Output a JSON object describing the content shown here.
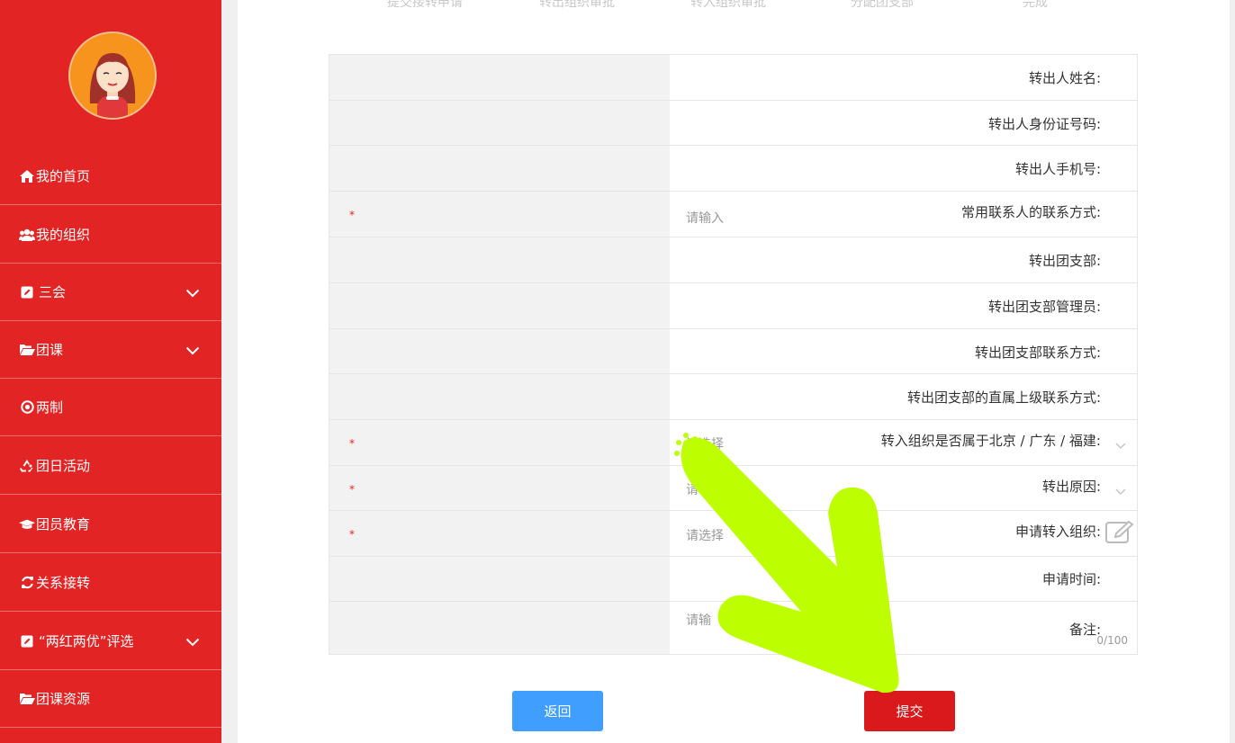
{
  "sidebar": {
    "items": [
      {
        "label": "我的首页",
        "icon": "home-icon"
      },
      {
        "label": "我的组织",
        "icon": "users-icon"
      },
      {
        "label": "三会",
        "icon": "edit-icon",
        "expandable": true
      },
      {
        "label": "团课",
        "icon": "folder-open-icon",
        "expandable": true
      },
      {
        "label": "两制",
        "icon": "target-icon"
      },
      {
        "label": "团日活动",
        "icon": "recycle-icon"
      },
      {
        "label": "团员教育",
        "icon": "graduation-cap-icon"
      },
      {
        "label": "关系接转",
        "icon": "refresh-icon"
      },
      {
        "label": "“两红两优”评选",
        "icon": "edit-icon",
        "expandable": true
      },
      {
        "label": "团课资源",
        "icon": "folder-open-icon"
      }
    ]
  },
  "steps": [
    "提交接转申请",
    "转出组织审批",
    "转入组织审批",
    "分配团支部",
    "完成"
  ],
  "form": {
    "rows": [
      {
        "label": "转出人姓名:",
        "required": false,
        "value": ""
      },
      {
        "label": "转出人身份证号码:",
        "required": false,
        "value": ""
      },
      {
        "label": "转出人手机号:",
        "required": false,
        "value": ""
      },
      {
        "label": "常用联系人的联系方式:",
        "required": true,
        "placeholder": "请输入"
      },
      {
        "label": "转出团支部:",
        "required": false,
        "value": ""
      },
      {
        "label": "转出团支部管理员:",
        "required": false,
        "value": ""
      },
      {
        "label": "转出团支部联系方式:",
        "required": false,
        "value": ""
      },
      {
        "label": "转出团支部的直属上级联系方式:",
        "required": false,
        "value": ""
      },
      {
        "label": "转入组织是否属于北京 / 广东 / 福建:",
        "required": true,
        "placeholder": "请选择",
        "type": "select"
      },
      {
        "label": "转出原因:",
        "required": true,
        "placeholder": "请",
        "type": "select"
      },
      {
        "label": "申请转入组织:",
        "required": true,
        "placeholder": "请选择",
        "type": "picker"
      },
      {
        "label": "申请时间:",
        "required": false,
        "value": ""
      },
      {
        "label": "备注:",
        "required": false,
        "placeholder": "请输",
        "type": "textarea",
        "counter": "0/100"
      }
    ],
    "required_mark": "*"
  },
  "buttons": {
    "back": "返回",
    "submit": "提交"
  },
  "colors": {
    "sidebar": "#e32424",
    "primary": "#409eff",
    "submit": "#d9191c",
    "annotation_arrow": "#bdff00"
  }
}
